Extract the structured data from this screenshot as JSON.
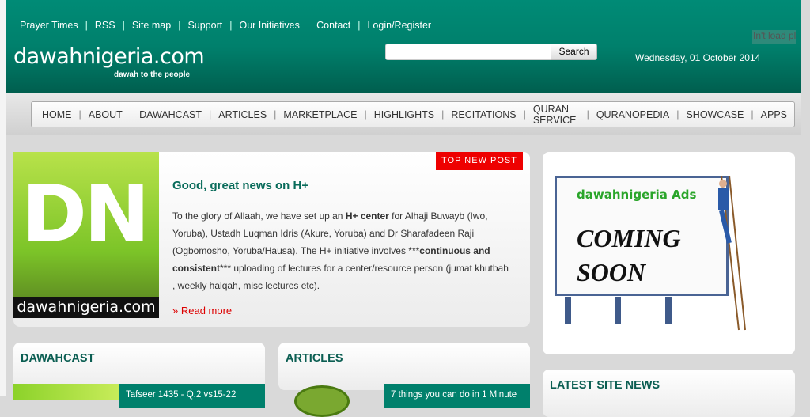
{
  "top_links": [
    "Prayer Times",
    "RSS",
    "Site map",
    "Support",
    "Our Initiatives",
    "Contact",
    "Login/Register"
  ],
  "site": {
    "name": "dawahnigeria.com",
    "tagline": "dawah to the people"
  },
  "search": {
    "value": "",
    "button": "Search"
  },
  "date": "Wednesday, 01 October 2014",
  "broken_image_text": "In't load pl",
  "nav": [
    "HOME",
    "ABOUT",
    "DAWAHCAST",
    "ARTICLES",
    "MARKETPLACE",
    "HIGHLIGHTS",
    "RECITATIONS",
    "QURAN SERVICE",
    "QURANOPEDIA",
    "SHOWCASE",
    "APPS"
  ],
  "featured": {
    "image_logo": "DN",
    "image_caption": "dawahnigeria.com",
    "badge": "TOP NEW  POST",
    "title": "Good, great news on H+",
    "p1": "To the glory of Allaah, we have set up an ",
    "b1": "H+ center",
    "p2": " for Alhaji Buwayb (Iwo, Yoruba), Ustadh Luqman Idris (Akure, Yoruba) and Dr Sharafadeen Raji (Ogbomosho, Yoruba/Hausa). The H+ initiative  involves ***",
    "b2": "continuous and consistent",
    "p3": "*** uploading of lectures for a center/resource person (jumat khutbah , weekly halqah, misc lectures etc).",
    "read_more": "Read more"
  },
  "ad": {
    "title": "dawahnigeria Ads",
    "line1": "COMING",
    "line2": "SOON"
  },
  "sections": {
    "dawahcast": {
      "title": "DAWAHCAST",
      "item": "Tafseer 1435 - Q.2 vs15-22"
    },
    "articles": {
      "title": "ARTICLES",
      "item": "7 things you can do in 1 Minute"
    },
    "latest": {
      "title": "LATEST SITE NEWS"
    }
  }
}
